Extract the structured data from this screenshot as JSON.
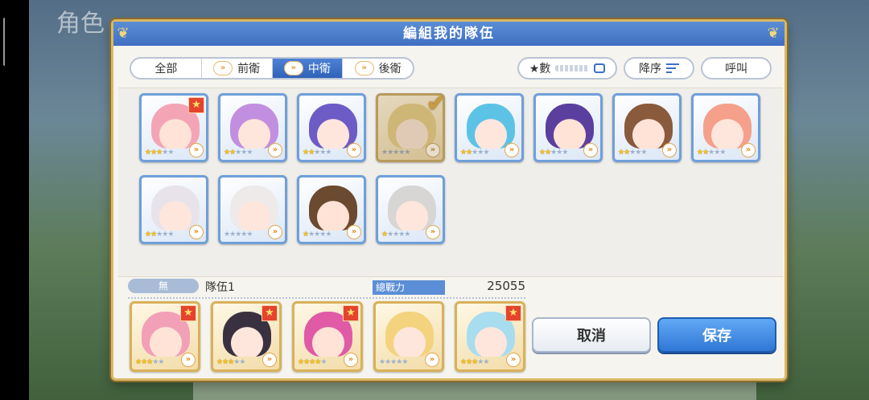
{
  "background": {
    "title": "角色"
  },
  "dialog": {
    "title": "編組我的隊伍",
    "filters": [
      {
        "label": "全部",
        "icon": "",
        "active": false
      },
      {
        "label": "前衛",
        "icon": "position-front-icon",
        "active": false
      },
      {
        "label": "中衛",
        "icon": "position-middle-icon",
        "active": true
      },
      {
        "label": "後衛",
        "icon": "position-back-icon",
        "active": false
      }
    ],
    "count_label": "★數",
    "sort_label": "降序",
    "call_label": "呼叫"
  },
  "roster": [
    {
      "stars": 3,
      "max": 5,
      "badge": true,
      "hair": "#f4a5b5",
      "skin": "#ffe3d6",
      "selected": false
    },
    {
      "stars": 2,
      "max": 5,
      "badge": false,
      "hair": "#c28fe0",
      "skin": "#ffe6dc",
      "selected": false
    },
    {
      "stars": 2,
      "max": 5,
      "badge": false,
      "hair": "#6d5bc6",
      "skin": "#ffe6dc",
      "selected": false
    },
    {
      "stars": 0,
      "max": 5,
      "badge": false,
      "hair": "#f0d27a",
      "skin": "#ffe6dc",
      "selected": true
    },
    {
      "stars": 2,
      "max": 5,
      "badge": false,
      "hair": "#5cc3e6",
      "skin": "#ffe6dc",
      "selected": false
    },
    {
      "stars": 2,
      "max": 5,
      "badge": false,
      "hair": "#5b3f9e",
      "skin": "#ffe3d6",
      "selected": false
    },
    {
      "stars": 2,
      "max": 5,
      "badge": false,
      "hair": "#8a5a3c",
      "skin": "#ffe3d6",
      "selected": false
    },
    {
      "stars": 2,
      "max": 5,
      "badge": false,
      "hair": "#f5a08a",
      "skin": "#ffe6dc",
      "selected": false
    },
    {
      "stars": 2,
      "max": 5,
      "badge": false,
      "hair": "#e8e3ea",
      "skin": "#ffe6dc",
      "selected": false
    },
    {
      "stars": 0,
      "max": 5,
      "badge": false,
      "hair": "#eeeaea",
      "skin": "#ffe6dc",
      "selected": false
    },
    {
      "stars": 1,
      "max": 5,
      "badge": false,
      "hair": "#6b4a30",
      "skin": "#ffe3d6",
      "selected": false
    },
    {
      "stars": 1,
      "max": 5,
      "badge": false,
      "hair": "#d8d6d4",
      "skin": "#ffe6dc",
      "selected": false
    }
  ],
  "team": {
    "tag": "無",
    "name": "隊伍1",
    "power_label": "總戰力",
    "power_value": "25055"
  },
  "party": [
    {
      "stars": 3,
      "max": 5,
      "badge": true,
      "hair": "#f2a0b8",
      "skin": "#ffe3d6"
    },
    {
      "stars": 3,
      "max": 5,
      "badge": true,
      "hair": "#3a3140",
      "skin": "#ffe6dc"
    },
    {
      "stars": 4,
      "max": 5,
      "badge": true,
      "hair": "#e05aa6",
      "skin": "#ffe3d6"
    },
    {
      "stars": 0,
      "max": 5,
      "badge": false,
      "hair": "#f3d37e",
      "skin": "#ffe6dc"
    },
    {
      "stars": 3,
      "max": 5,
      "badge": true,
      "hair": "#a8dcef",
      "skin": "#ffe6dc"
    }
  ],
  "actions": {
    "cancel_label": "取消",
    "save_label": "保存"
  }
}
